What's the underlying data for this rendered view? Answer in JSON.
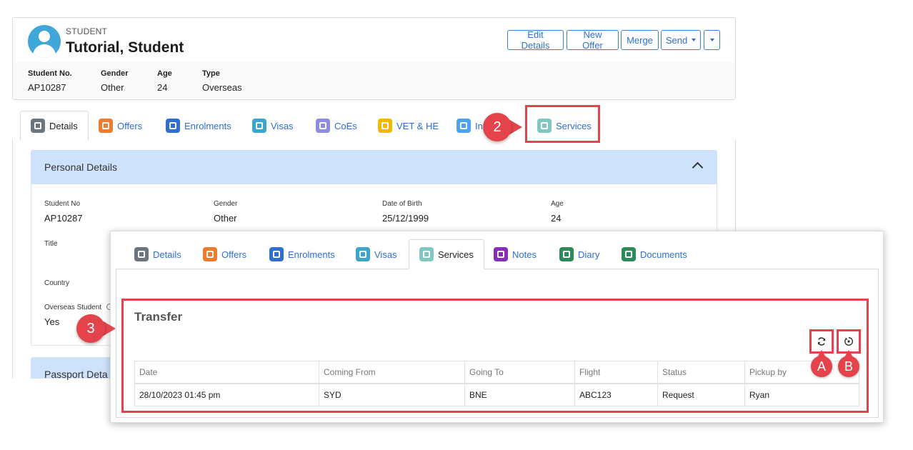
{
  "student": {
    "kicker": "STUDENT",
    "name": "Tutorial, Student",
    "buttons": {
      "edit": "Edit Details",
      "new_offer": "New Offer",
      "merge": "Merge",
      "send": "Send"
    },
    "fields": [
      {
        "label": "Student No.",
        "value": "AP10287"
      },
      {
        "label": "Gender",
        "value": "Other"
      },
      {
        "label": "Age",
        "value": "24"
      },
      {
        "label": "Type",
        "value": "Overseas"
      }
    ]
  },
  "back_tabs": [
    {
      "label": "Details",
      "color": "#6c757d"
    },
    {
      "label": "Offers",
      "color": "#f07b2e"
    },
    {
      "label": "Enrolments",
      "color": "#2f6fd0"
    },
    {
      "label": "Visas",
      "color": "#3aa6c9"
    },
    {
      "label": "CoEs",
      "color": "#8e8de0"
    },
    {
      "label": "VET & HE",
      "color": "#f5b800"
    },
    {
      "label": "In",
      "color": "#4ca3f0"
    },
    {
      "label": "Services",
      "color": "#7fc7c0"
    }
  ],
  "personal_details": {
    "title": "Personal Details",
    "fields": [
      {
        "label": "Student No",
        "value": "AP10287"
      },
      {
        "label": "Gender",
        "value": "Other"
      },
      {
        "label": "Date of Birth",
        "value": "25/12/1999"
      },
      {
        "label": "Age",
        "value": "24"
      },
      {
        "label": "Title",
        "value": ""
      },
      {
        "label": "Country",
        "value": ""
      },
      {
        "label": "Overseas Student",
        "value": "Yes"
      }
    ],
    "passport_title": "Passport Deta"
  },
  "front_tabs": [
    {
      "label": "Details",
      "color": "#6c757d"
    },
    {
      "label": "Offers",
      "color": "#f07b2e"
    },
    {
      "label": "Enrolments",
      "color": "#2f6fd0"
    },
    {
      "label": "Visas",
      "color": "#3aa6c9"
    },
    {
      "label": "Services",
      "color": "#7fc7c0"
    },
    {
      "label": "Notes",
      "color": "#8a2bb8"
    },
    {
      "label": "Diary",
      "color": "#2e8b57"
    },
    {
      "label": "Documents",
      "color": "#2e8b57"
    }
  ],
  "transfer": {
    "title": "Transfer",
    "columns": [
      "Date",
      "Coming From",
      "Going To",
      "Flight",
      "Status",
      "Pickup by"
    ],
    "rows": [
      [
        "28/10/2023 01:45 pm",
        "SYD",
        "BNE",
        "ABC123",
        "Request",
        "Ryan"
      ]
    ]
  },
  "callouts": {
    "two": "2",
    "three": "3",
    "a": "A",
    "b": "B"
  },
  "colors": {
    "accent": "#2f6fd0",
    "callout": "#e5434b",
    "panel_header": "#cfe2fb"
  }
}
